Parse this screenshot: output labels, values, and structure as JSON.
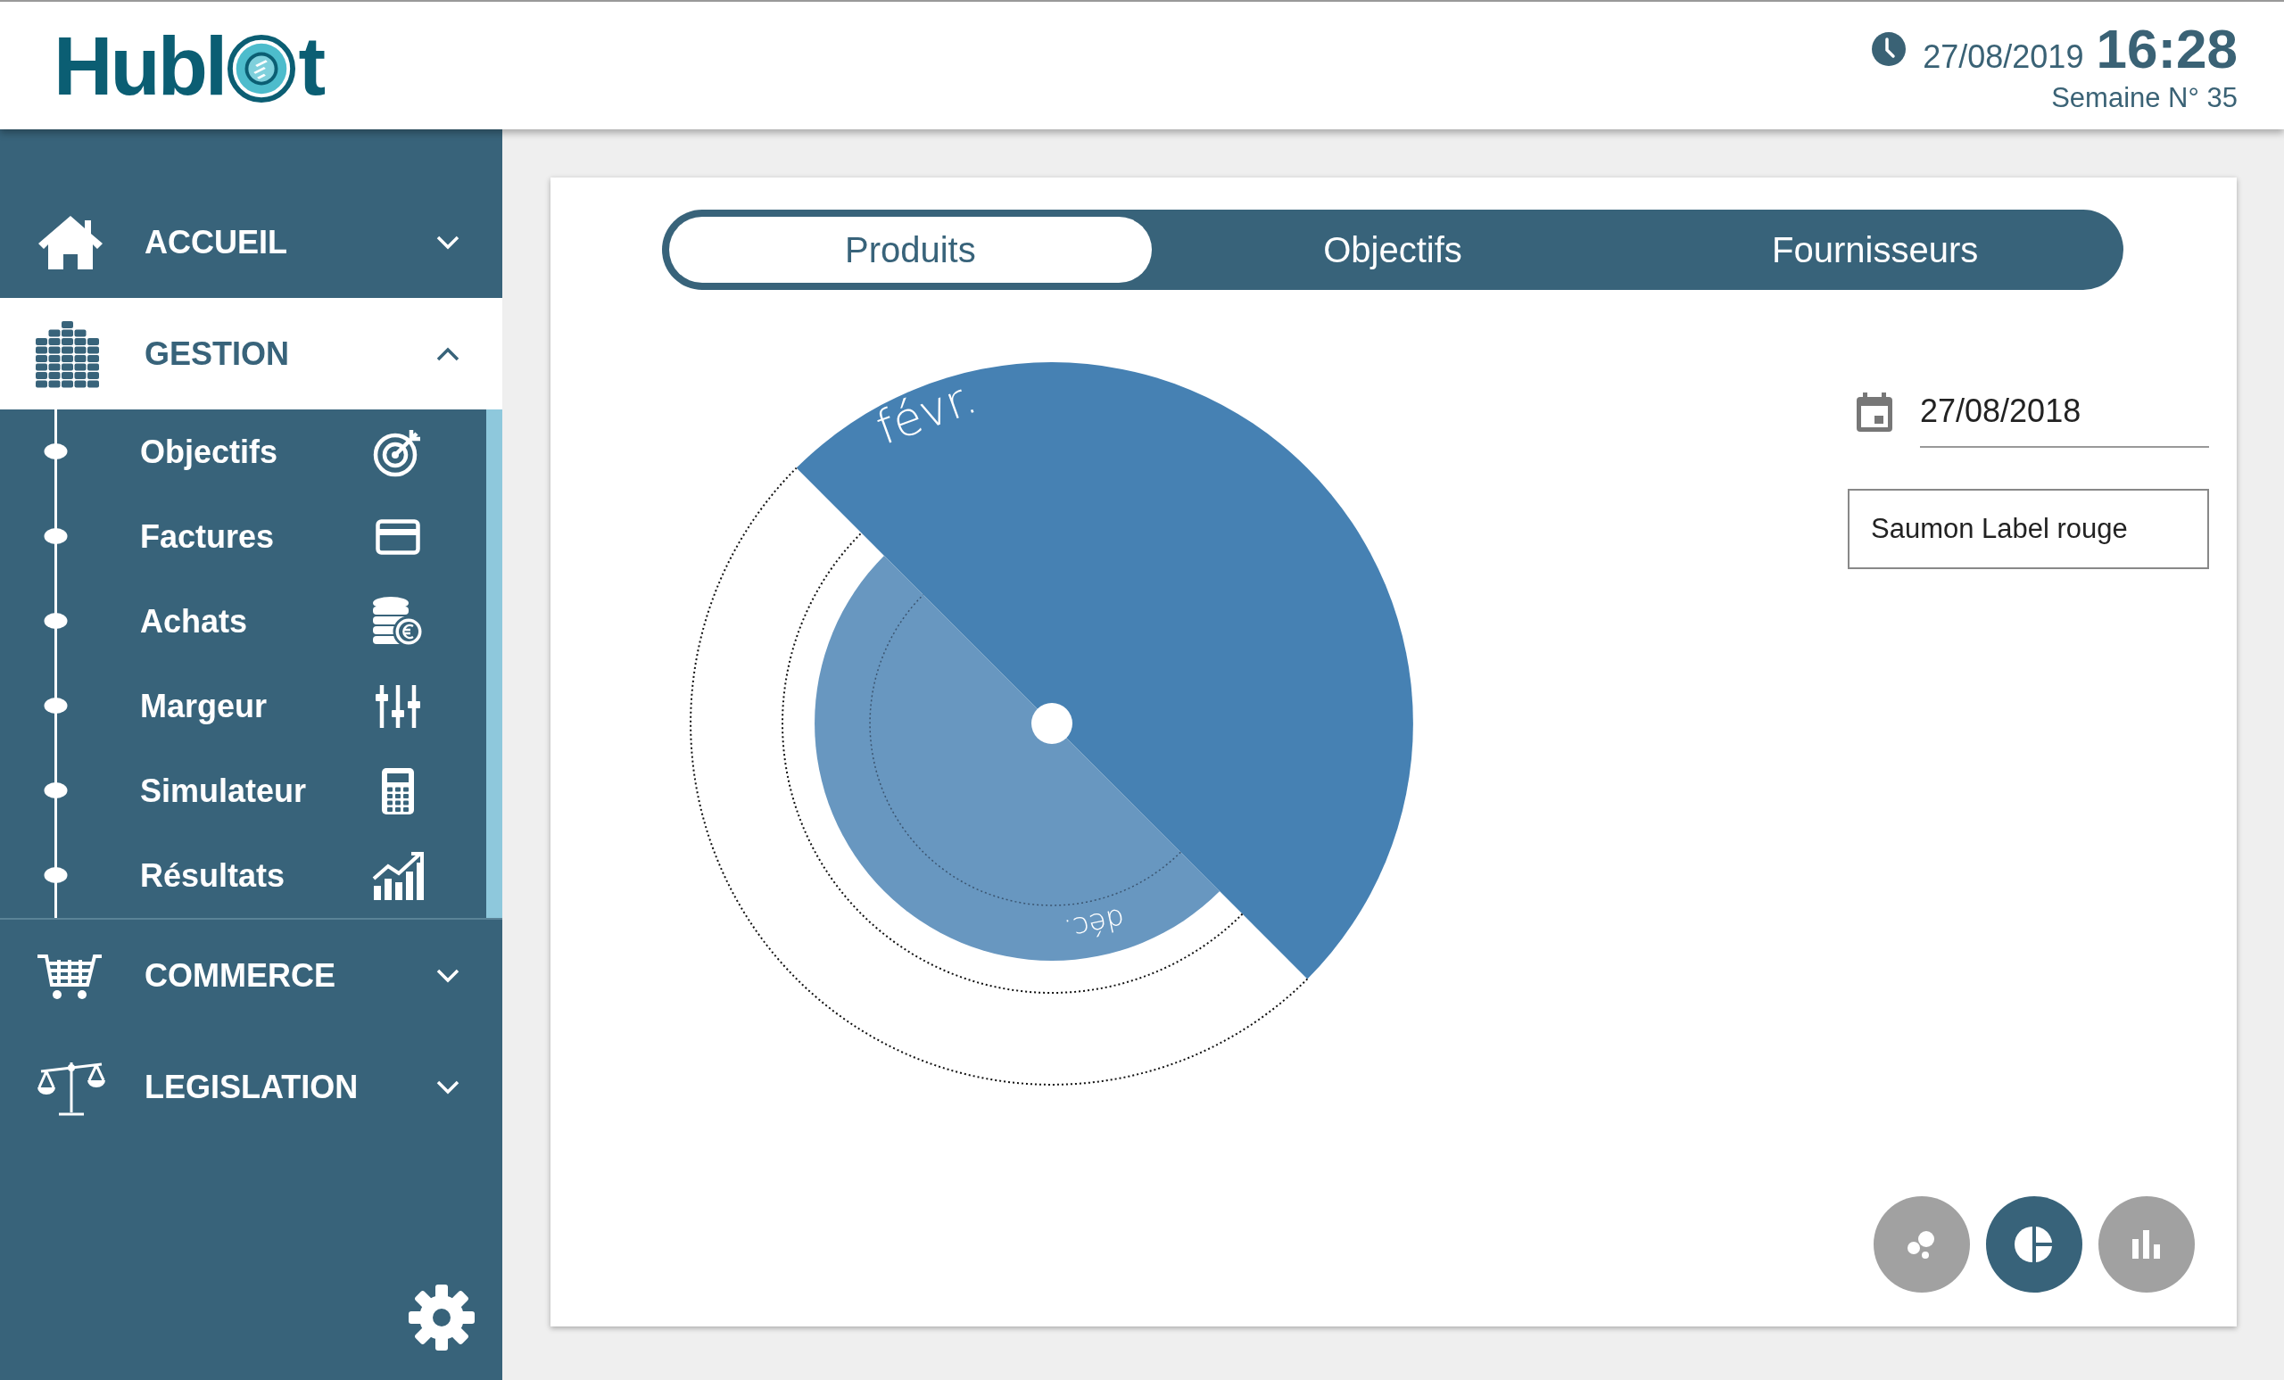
{
  "header": {
    "logo": {
      "text_before": "Hubl",
      "text_after": "t"
    },
    "date": "27/08/2019",
    "time": "16:28",
    "week": "Semaine N° 35"
  },
  "sidebar": {
    "items": [
      {
        "label": "ACCUEIL",
        "selected": false,
        "expanded": false
      },
      {
        "label": "GESTION",
        "selected": true,
        "expanded": true,
        "children": [
          {
            "label": "Objectifs"
          },
          {
            "label": "Factures"
          },
          {
            "label": "Achats"
          },
          {
            "label": "Margeur"
          },
          {
            "label": "Simulateur"
          },
          {
            "label": "Résultats"
          }
        ]
      },
      {
        "label": "COMMERCE",
        "selected": false,
        "expanded": false
      },
      {
        "label": "LEGISLATION",
        "selected": false,
        "expanded": false
      }
    ]
  },
  "tabs": [
    {
      "label": "Produits",
      "selected": true
    },
    {
      "label": "Objectifs",
      "selected": false
    },
    {
      "label": "Fournisseurs",
      "selected": false
    }
  ],
  "chart": {
    "labels": [
      "févr.",
      "déc."
    ]
  },
  "date_field": {
    "value": "27/08/2018"
  },
  "product_select": {
    "value": "Saumon Label rouge"
  },
  "view_buttons": [
    {
      "selected": false
    },
    {
      "selected": true
    },
    {
      "selected": false
    }
  ]
}
